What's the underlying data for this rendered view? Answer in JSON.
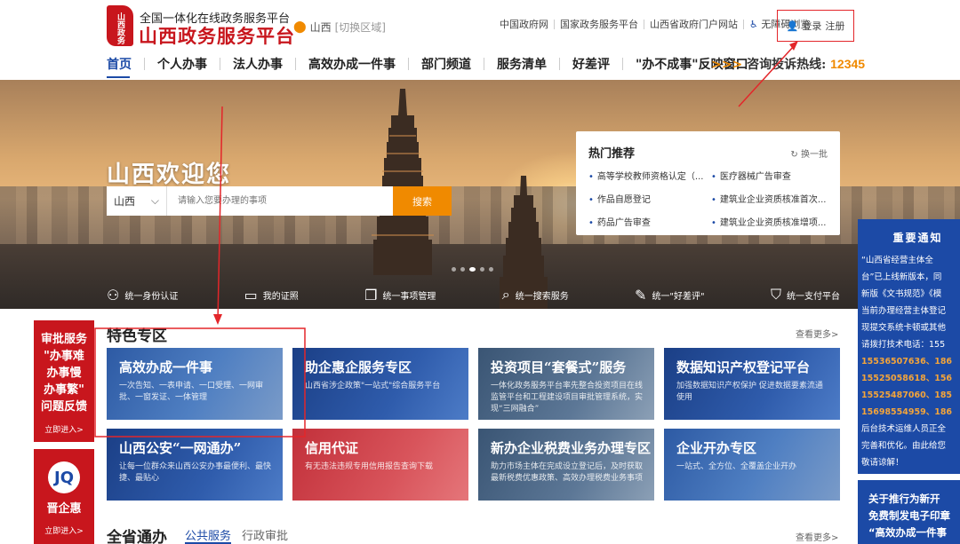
{
  "header": {
    "logo_text": "山西政务",
    "subtitle": "全国一体化在线政务服务平台",
    "title": "山西政务服务平台",
    "location": "山西",
    "switch_region": "[切换区域]",
    "top_links": [
      "中国政府网",
      "国家政务服务平台",
      "山西省政府门户网站",
      "无障碍浏览"
    ],
    "login": "登录",
    "register": "注册"
  },
  "nav": {
    "items": [
      "首页",
      "个人办事",
      "法人办事",
      "高效办成一件事",
      "部门频道",
      "服务清单",
      "好差评",
      "\"办不成事\"反映窗口"
    ],
    "hotline_label": "咨询投诉热线:",
    "hotline_number": "12345"
  },
  "hero": {
    "welcome": "山西欢迎您",
    "search_region": "山西",
    "search_placeholder": "请输入您要办理的事项",
    "search_button": "搜索",
    "hot_title": "热门推荐",
    "hot_refresh": "换一批",
    "hot_items": [
      "高等学校教师资格认定（...",
      "医疗器械广告审查",
      "作品自愿登记",
      "建筑业企业资质核准首次...",
      "药品广告审查",
      "建筑业企业资质核准增项..."
    ],
    "services": [
      "统一身份认证",
      "我的证照",
      "统一事项管理",
      "统一搜索服务",
      "统一\"好差评\"",
      "统一支付平台"
    ]
  },
  "float_left": {
    "feedback_text": [
      "审批服务",
      "\"办事难",
      "办事慢",
      "办事繁\"",
      "问题反馈"
    ],
    "feedback_enter": "立即进入>",
    "jqh_logo": "JQ",
    "jqh_title": "晋企惠",
    "jqh_enter": "立即进入>"
  },
  "featured": {
    "title": "特色专区",
    "more": "查看更多>",
    "cards": [
      {
        "title": "高效办成一件事",
        "desc": "一次告知、一表申请、一口受理、一网审批、一窗发证、一体管理"
      },
      {
        "title": "助企惠企服务专区",
        "desc": "山西省涉企政策\"一站式\"综合服务平台"
      },
      {
        "title": "投资项目“套餐式”服务",
        "desc": "一体化政务服务平台率先整合投资项目在线监管平台和工程建设项目审批管理系统，实现“三网融合”"
      },
      {
        "title": "数据知识产权登记平台",
        "desc": "加强数据知识产权保护 促进数据要素流通使用"
      },
      {
        "title": "山西公安“一网通办”",
        "desc": "让每一位群众来山西公安办事最便利、最快捷、最贴心"
      },
      {
        "title": "信用代证",
        "desc": "有无违法违规专用信用报告查询下载"
      },
      {
        "title": "新办企业税费业务办理专区",
        "desc": "助力市场主体在完成设立登记后，及时获取最新税费优惠政策、高效办理税费业务事项"
      },
      {
        "title": "企业开办专区",
        "desc": "一站式、全方位、全覆盖企业开办"
      }
    ]
  },
  "notice": {
    "title": "重要通知",
    "lines": [
      "“山西省经营主体全",
      "台”已上线新版本，同",
      "新版《文书规范》《模",
      "当前办理经营主体登记",
      "现提交系统卡顿或其他",
      "请拨打技术电话：155"
    ],
    "phones": [
      "15536507636、186",
      "15525058618、156",
      "15525487060、185",
      "15698554959、186"
    ],
    "tail": [
      "后台技术运维人员正全",
      "完善和优化。由此给您",
      "敬请谅解！"
    ],
    "notice2": [
      "关于推行为新开",
      "免费制发电子印章",
      "“高效办成一件事"
    ]
  },
  "bottom": {
    "title": "全省通办",
    "tab_public": "公共服务",
    "tab_admin": "行政审批",
    "more": "查看更多>"
  },
  "colors": {
    "brand_red": "#c8161d",
    "brand_blue": "#1c4aa6",
    "accent_orange": "#f08a00",
    "annotation_red": "#e3262a"
  }
}
